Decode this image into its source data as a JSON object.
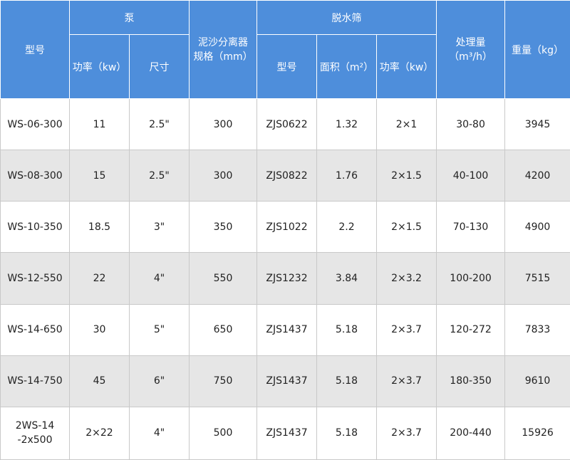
{
  "header": {
    "model": "型号",
    "pump": "泵",
    "pump_power": "功率（kw）",
    "pump_size": "尺寸",
    "separator_line1": "泥沙分离器",
    "separator_line2": "规格（mm）",
    "dewatering_screen": "脱水筛",
    "screen_model": "型号",
    "screen_area": "面积（m²）",
    "screen_power": "功率（kw）",
    "capacity_line1": "处理量",
    "capacity_line2": "（m³/h）",
    "weight": "重量（kg）"
  },
  "rows": [
    {
      "model": "WS-06-300",
      "pump_power": "11",
      "pump_size": "2.5\"",
      "separator": "300",
      "screen_model": "ZJS0622",
      "screen_area": "1.32",
      "screen_power": "2×1",
      "capacity": "30-80",
      "weight": "3945"
    },
    {
      "model": "WS-08-300",
      "pump_power": "15",
      "pump_size": "2.5\"",
      "separator": "300",
      "screen_model": "ZJS0822",
      "screen_area": "1.76",
      "screen_power": "2×1.5",
      "capacity": "40-100",
      "weight": "4200"
    },
    {
      "model": "WS-10-350",
      "pump_power": "18.5",
      "pump_size": "3\"",
      "separator": "350",
      "screen_model": "ZJS1022",
      "screen_area": "2.2",
      "screen_power": "2×1.5",
      "capacity": "70-130",
      "weight": "4900"
    },
    {
      "model": "WS-12-550",
      "pump_power": "22",
      "pump_size": "4\"",
      "separator": "550",
      "screen_model": "ZJS1232",
      "screen_area": "3.84",
      "screen_power": "2×3.2",
      "capacity": "100-200",
      "weight": "7515"
    },
    {
      "model": "WS-14-650",
      "pump_power": "30",
      "pump_size": "5\"",
      "separator": "650",
      "screen_model": "ZJS1437",
      "screen_area": "5.18",
      "screen_power": "2×3.7",
      "capacity": "120-272",
      "weight": "7833"
    },
    {
      "model": "WS-14-750",
      "pump_power": "45",
      "pump_size": "6\"",
      "separator": "750",
      "screen_model": "ZJS1437",
      "screen_area": "5.18",
      "screen_power": "2×3.7",
      "capacity": "180-350",
      "weight": "9610"
    },
    {
      "model_line1": "2WS-14",
      "model_line2": "-2x500",
      "pump_power": "2×22",
      "pump_size": "4\"",
      "separator": "500",
      "screen_model": "ZJS1437",
      "screen_area": "5.18",
      "screen_power": "2×3.7",
      "capacity": "200-440",
      "weight": "15926"
    }
  ],
  "colors": {
    "header_bg": "#4e8edb",
    "header_text": "#ffffff",
    "row_alt_bg": "#e6e6e6",
    "border": "#c9c9c9"
  }
}
